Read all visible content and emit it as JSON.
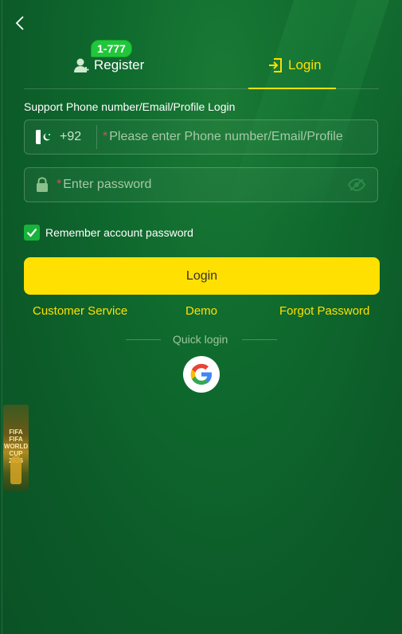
{
  "tabs": {
    "register_label": "Register",
    "register_badge": "1-777",
    "login_label": "Login"
  },
  "form": {
    "support_text": "Support Phone number/Email/Profile Login",
    "country_code": "+92",
    "account_required_mark": "*",
    "account_placeholder": "Please enter Phone number/Email/Profile",
    "password_required_mark": "*",
    "password_placeholder": "Enter password",
    "remember_label": "Remember account password",
    "remember_checked": true,
    "login_button": "Login"
  },
  "links": {
    "customer_service": "Customer Service",
    "demo": "Demo",
    "forgot_password": "Forgot Password"
  },
  "quick_login": {
    "label": "Quick login",
    "provider_icon": "google-icon"
  },
  "promo": {
    "text_line1": "FIFA",
    "text_line2": "FIFA WORLD",
    "text_line3": "CUP 2026"
  },
  "colors": {
    "background": "#0e5e2b",
    "accent": "#ffe000",
    "checkbox": "#17b33b",
    "badge": "#21c73a"
  }
}
